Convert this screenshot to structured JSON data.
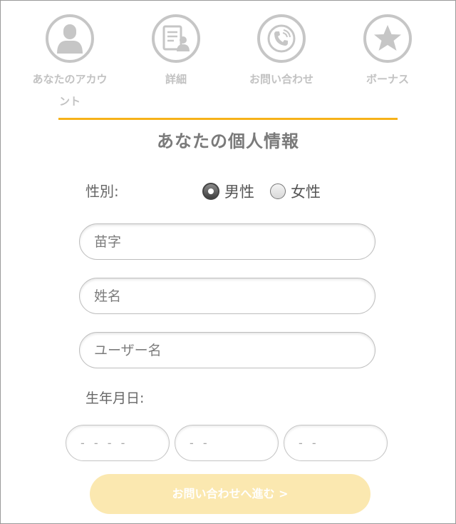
{
  "steps": [
    {
      "label": "あなたのアカウント",
      "icon": "user-icon"
    },
    {
      "label": "詳細",
      "icon": "document-user-icon"
    },
    {
      "label": "お問い合わせ",
      "icon": "phone-icon"
    },
    {
      "label": "ボーナス",
      "icon": "star-icon"
    }
  ],
  "colors": {
    "accent": "#f6b21a",
    "inactive_icon": "#c6c6c6",
    "button": "#fbe8b0"
  },
  "form": {
    "title": "あなたの個人情報",
    "gender": {
      "label": "性別:",
      "options": [
        {
          "label": "男性",
          "checked": true
        },
        {
          "label": "女性",
          "checked": false
        }
      ]
    },
    "last_name": {
      "placeholder": "苗字",
      "value": ""
    },
    "first_name": {
      "placeholder": "姓名",
      "value": ""
    },
    "username": {
      "placeholder": "ユーザー名",
      "value": ""
    },
    "dob": {
      "label": "生年月日:",
      "year_placeholder": "- - - -",
      "month_placeholder": "- -",
      "day_placeholder": "- -"
    },
    "next_button": "お問い合わせへ進む >"
  }
}
